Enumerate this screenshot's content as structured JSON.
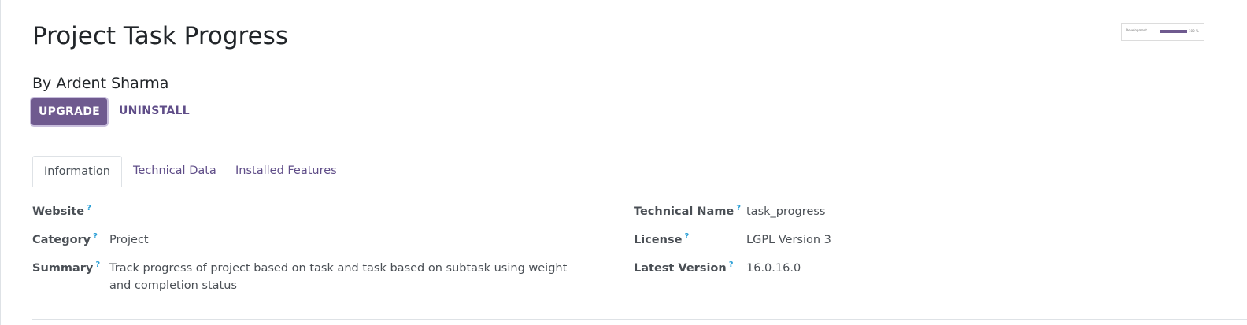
{
  "module": {
    "title": "Project Task Progress",
    "author": "By Ardent Sharma"
  },
  "actions": {
    "upgrade_label": "UPGRADE",
    "uninstall_label": "UNINSTALL"
  },
  "thumbnail": {
    "label": "Development",
    "progress_percent": 100,
    "percent_text": "100 %"
  },
  "tabs": [
    {
      "label": "Information",
      "active": true
    },
    {
      "label": "Technical Data",
      "active": false
    },
    {
      "label": "Installed Features",
      "active": false
    }
  ],
  "fields": {
    "website": {
      "label": "Website",
      "help": "?",
      "value": ""
    },
    "category": {
      "label": "Category",
      "help": "?",
      "value": "Project"
    },
    "summary": {
      "label": "Summary",
      "help": "?",
      "value": "Track progress of project based on task and task based on subtask using weight and completion status"
    },
    "technical_name": {
      "label": "Technical Name",
      "help": "?",
      "value": "task_progress"
    },
    "license": {
      "label": "License",
      "help": "?",
      "value": "LGPL Version 3"
    },
    "latest_version": {
      "label": "Latest Version",
      "help": "?",
      "value": "16.0.16.0"
    }
  },
  "colors": {
    "primary": "#6f5a8f",
    "link": "#5f4d88",
    "help": "#2a9fd6"
  }
}
